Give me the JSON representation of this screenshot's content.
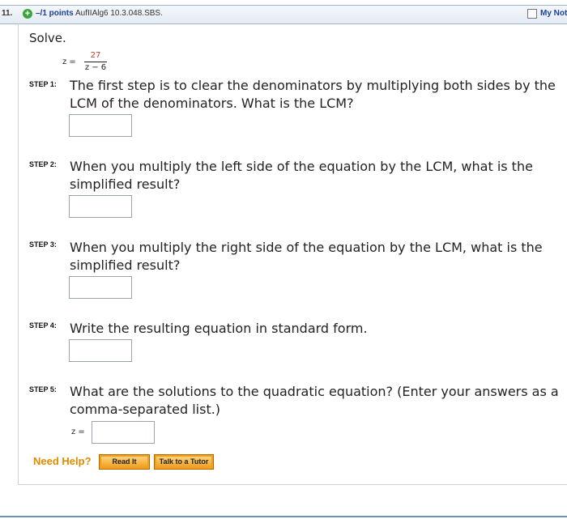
{
  "header": {
    "question_number": "11.",
    "points": "–/1 points",
    "question_code": "AufIIAlg6 10.3.048.SBS.",
    "notes_label": "My Notes"
  },
  "problem": {
    "instruction": "Solve.",
    "equation_lhs": "z =",
    "numerator": "27",
    "denominator": "z − 6"
  },
  "steps": [
    {
      "label": "STEP 1:",
      "text": "The first step is to clear the denominators by multiplying both sides by the LCM of the denominators. What is the LCM?"
    },
    {
      "label": "STEP 2:",
      "text": "When you multiply the left side of the equation by the LCM, what is the simplified result?"
    },
    {
      "label": "STEP 3:",
      "text": "When you multiply the right side of the equation by the LCM, what is the simplified result?"
    },
    {
      "label": "STEP 4:",
      "text": "Write the resulting equation in standard form."
    },
    {
      "label": "STEP 5:",
      "text": "What are the solutions to the quadratic equation? (Enter your answers as a comma-separated list.)"
    }
  ],
  "answer_prefix": "z =",
  "help": {
    "label": "Need Help?",
    "read_button": "Read It",
    "tutor_button": "Talk to a Tutor"
  },
  "colors": {
    "accent": "#1a3fa0",
    "help_orange": "#e08a00",
    "fraction_numerator": "#c0392b"
  }
}
